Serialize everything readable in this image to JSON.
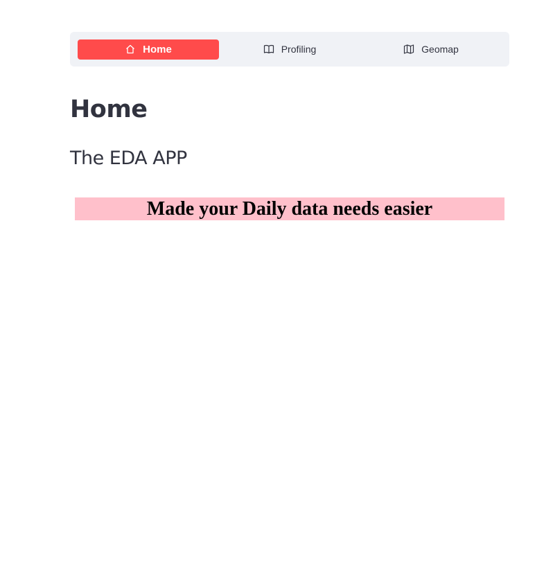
{
  "nav": {
    "items": [
      {
        "label": "Home",
        "icon": "house-icon",
        "active": true
      },
      {
        "label": "Profiling",
        "icon": "book-icon",
        "active": false
      },
      {
        "label": "Geomap",
        "icon": "map-icon",
        "active": false
      }
    ]
  },
  "page": {
    "title": "Home",
    "subtitle": "The EDA APP",
    "banner": "Made your Daily data needs easier"
  },
  "colors": {
    "accent": "#ff4b4b",
    "nav_background": "#f0f2f6",
    "banner_background": "#ffc0cb",
    "text": "#31333f"
  }
}
